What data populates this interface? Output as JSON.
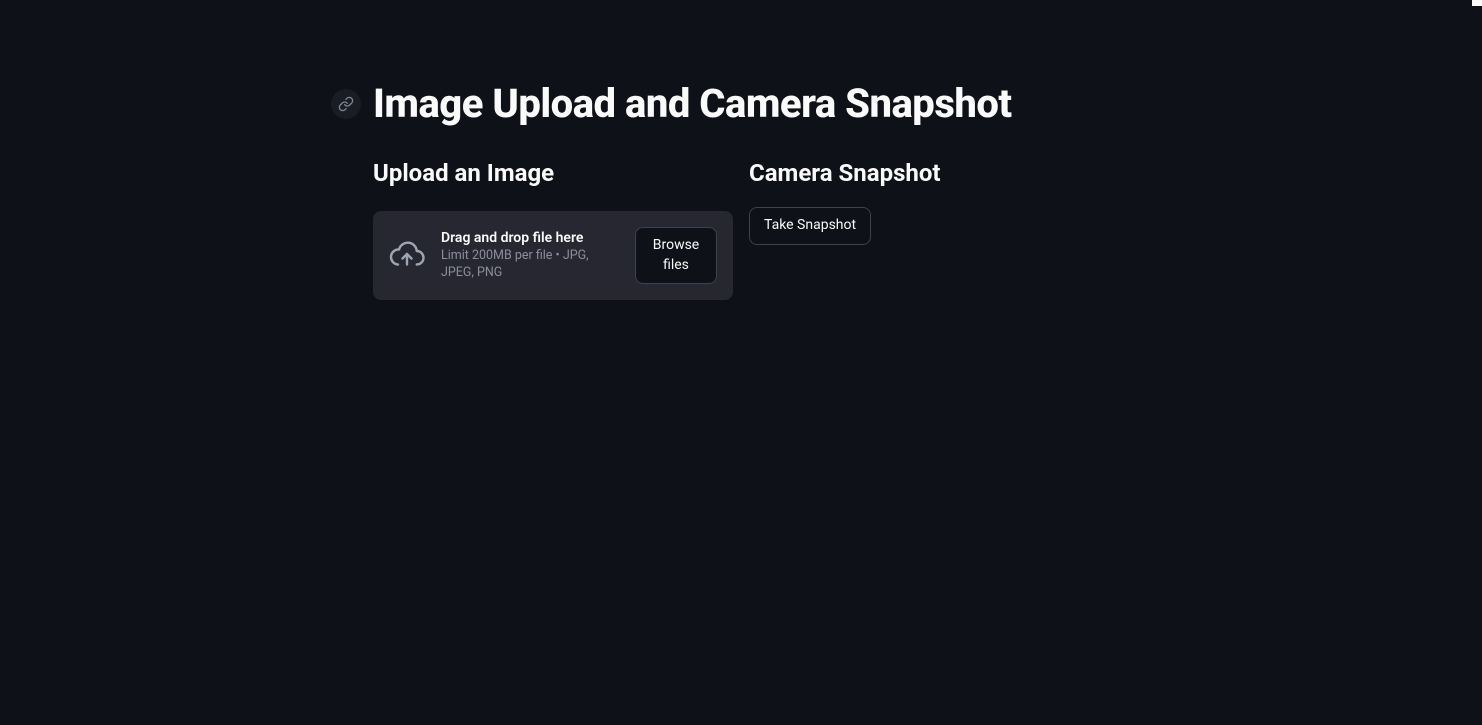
{
  "title": "Image Upload and Camera Snapshot",
  "left": {
    "heading": "Upload an Image",
    "uploader": {
      "primary": "Drag and drop file here",
      "secondary": "Limit 200MB per file • JPG, JPEG, PNG",
      "browse_label": "Browse files"
    }
  },
  "right": {
    "heading": "Camera Snapshot",
    "snapshot_label": "Take Snapshot"
  }
}
